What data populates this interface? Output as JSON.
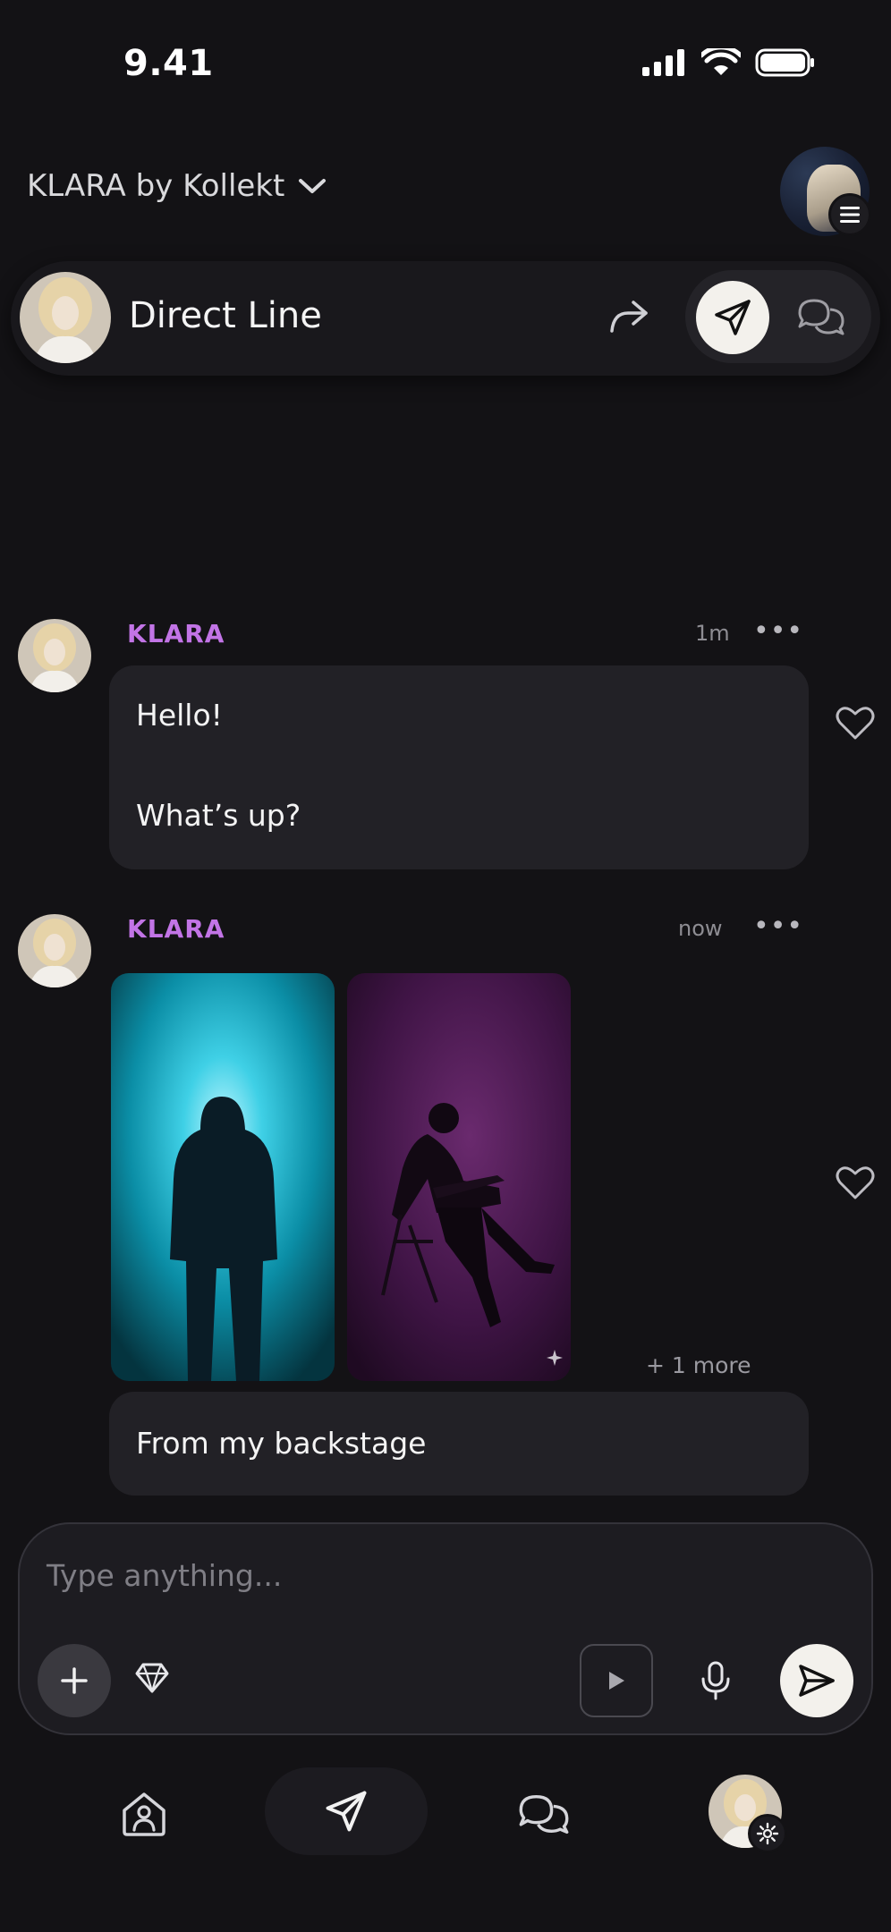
{
  "status_bar": {
    "time": "9.41"
  },
  "header": {
    "app_title": "KLARA by Kollekt"
  },
  "direct_line": {
    "title": "Direct Line"
  },
  "messages": [
    {
      "sender": "KLARA",
      "time": "1m",
      "more": "•••",
      "lines": [
        "Hello!",
        "What’s up?"
      ]
    },
    {
      "sender": "KLARA",
      "time": "now",
      "more": "•••",
      "more_count": "+ 1 more",
      "caption": "From my backstage"
    }
  ],
  "composer": {
    "placeholder": "Type anything..."
  },
  "colors": {
    "accent_name": "#c274e6",
    "background": "#131215",
    "bubble": "#222126"
  }
}
